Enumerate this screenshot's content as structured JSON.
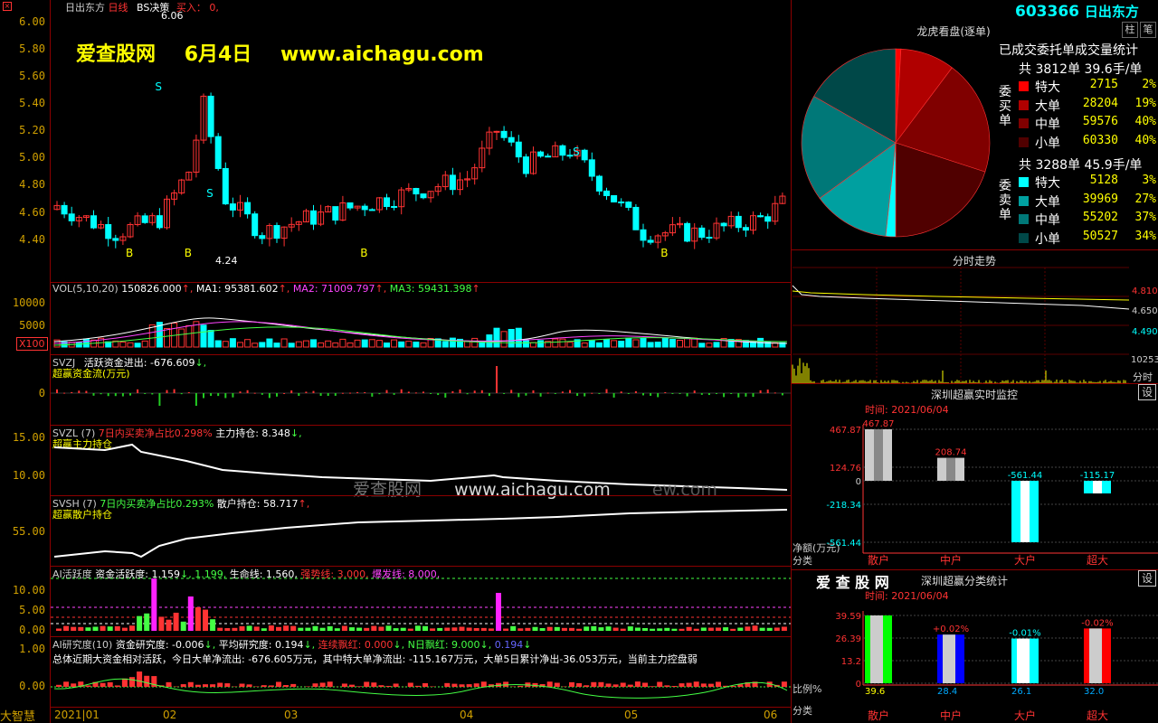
{
  "header": {
    "name": "日出东方",
    "period": "日线",
    "indicator": "BS决策",
    "buy_label": "买入：",
    "buy_value": "0,",
    "watermark_site": "爱查股网",
    "watermark_date": "6月4日",
    "watermark_url": "www.aichagu.com",
    "price_label": "6.06",
    "low_label": "4.24",
    "center_watermark_site": "爱查股网",
    "center_watermark_url": "www.aichagu.com",
    "center_watermark_tail": "ew.com"
  },
  "price_axis": [
    "6.00",
    "5.80",
    "5.60",
    "5.40",
    "5.20",
    "5.00",
    "4.80",
    "4.60",
    "4.40"
  ],
  "date_axis": {
    "corner": "大智慧",
    "labels": [
      "2021|01",
      "02",
      "03",
      "04",
      "05",
      "06"
    ]
  },
  "vol": {
    "title": "VOL(5,10,20)",
    "value": "150826.000",
    "ma1": "MA1: 95381.602",
    "ma2": "MA2: 71009.797",
    "ma3": "MA3: 59431.398",
    "axis": [
      "10000",
      "5000"
    ],
    "unit": "X100"
  },
  "svzj": {
    "title": "SVZJ",
    "desc": "活跃资金进出: -676.609",
    "sub": "超赢资金流(万元)",
    "axis": "0"
  },
  "svzl": {
    "title": "SVZL (7)",
    "desc1": "7日内买卖净占比0.298%",
    "desc2": "主力持仓: 8.348",
    "sub": "超赢主力持仓",
    "axis": [
      "15.00",
      "10.00"
    ]
  },
  "svsh": {
    "title": "SVSH (7)",
    "desc1": "7日内买卖净占比0.293%",
    "desc2": "散户持仓: 58.717",
    "sub": "超赢散户持仓",
    "axis": "55.00"
  },
  "ai_active": {
    "title": "AI活跃度",
    "d1": "资金活跃度: 1.159",
    "d2": "1.199,",
    "d3": "生命线: 1.560,",
    "d4": "强势线: 3.000,",
    "d5": "爆发线: 8.000,",
    "axis": [
      "10.00",
      "5.00",
      "0.00"
    ]
  },
  "ai_research": {
    "title": "AI研究度(10)",
    "d1": "资金研究度: -0.006",
    "d2": "平均研究度: 0.194",
    "d3": "连续飘红: 0.000",
    "d4": "N日飘红: 9.000",
    "d5": "0.194",
    "summary": "总体近期大资金相对活跃，今日大单净流出: -676.605万元，其中特大单净流出: -115.167万元，大单5日累计净出-36.053万元，当前主力控盘弱",
    "axis": [
      "1.00",
      "0.00"
    ]
  },
  "right": {
    "code": "603366",
    "name": "日出东方",
    "btn1": "柱",
    "btn2": "笔",
    "panel_title": "龙虎看盘(逐单)",
    "stat_title": "已成交委托单成交量统计",
    "buy": {
      "label": "委买单",
      "total": "共 3812单 39.6手/单",
      "rows": [
        {
          "name": "特大",
          "val": "2715",
          "pct": "2%",
          "color": "#ff0000"
        },
        {
          "name": "大单",
          "val": "28204",
          "pct": "19%",
          "color": "#b00000"
        },
        {
          "name": "中单",
          "val": "59576",
          "pct": "40%",
          "color": "#800000"
        },
        {
          "name": "小单",
          "val": "60330",
          "pct": "40%",
          "color": "#500000"
        }
      ]
    },
    "sell": {
      "label": "委卖单",
      "total": "共 3288单 45.9手/单",
      "rows": [
        {
          "name": "特大",
          "val": "5128",
          "pct": "3%",
          "color": "#00ffff"
        },
        {
          "name": "大单",
          "val": "39969",
          "pct": "27%",
          "color": "#00a0a0"
        },
        {
          "name": "中单",
          "val": "55202",
          "pct": "37%",
          "color": "#007878"
        },
        {
          "name": "小单",
          "val": "50527",
          "pct": "34%",
          "color": "#004848"
        }
      ]
    },
    "intraday_title": "分时走势",
    "intraday_axis": [
      "4.810",
      "4.650",
      "4.490"
    ],
    "intraday_vol": "10253",
    "intraday_btn": "分时",
    "monitor_title": "深圳超赢实时监控",
    "monitor_btn": "设",
    "monitor_time": "时间: 2021/06/04",
    "monitor_axis": [
      "467.87",
      "124.76",
      "0",
      "-218.34",
      "-561.44"
    ],
    "monitor_ylabel": "净额(万元)",
    "monitor_xlabel": "分类",
    "monitor_bars": [
      {
        "cat": "散户",
        "value": "467.87"
      },
      {
        "cat": "中户",
        "value": "208.74"
      },
      {
        "cat": "大户",
        "value": "-561.44"
      },
      {
        "cat": "超大",
        "value": "-115.17"
      }
    ],
    "class_watermark": "爱 查 股 网",
    "class_title": "深圳超赢分类统计",
    "class_btn": "设",
    "class_time": "时间: 2021/06/04",
    "class_axis": [
      "39.59",
      "26.39",
      "13.2",
      "0"
    ],
    "class_ylabel": "比例%",
    "class_xlabel": "分类",
    "class_bars": [
      {
        "cat": "散户",
        "value": "39.6",
        "delta": ""
      },
      {
        "cat": "中户",
        "value": "28.4",
        "delta": "+0.02%"
      },
      {
        "cat": "大户",
        "value": "26.1",
        "delta": "-0.01%"
      },
      {
        "cat": "超大",
        "value": "32.0",
        "delta": "-0.02%"
      }
    ]
  },
  "chart_data": [
    {
      "type": "pie",
      "title": "龙虎看盘(逐单)",
      "categories": [
        "委买特大",
        "委买大单",
        "委买中单",
        "委买小单",
        "委卖特大",
        "委卖大单",
        "委卖中单",
        "委卖小单"
      ],
      "values": [
        2715,
        28204,
        59576,
        60330,
        5128,
        39969,
        55202,
        50527
      ]
    },
    {
      "type": "bar",
      "title": "深圳超赢实时监控",
      "categories": [
        "散户",
        "中户",
        "大户",
        "超大"
      ],
      "values": [
        467.87,
        208.74,
        -561.44,
        -115.17
      ],
      "ylabel": "净额(万元)",
      "xlabel": "分类",
      "ylim": [
        -561.44,
        467.87
      ]
    },
    {
      "type": "bar",
      "title": "深圳超赢分类统计",
      "categories": [
        "散户",
        "中户",
        "大户",
        "超大"
      ],
      "values": [
        39.6,
        28.4,
        26.1,
        32.0
      ],
      "ylabel": "比例%",
      "xlabel": "分类",
      "ylim": [
        0,
        39.59
      ]
    }
  ],
  "colors": {
    "up": "#ff3333",
    "down": "#00ffff",
    "border": "#8b0000",
    "axis_text": "#d0a000",
    "watermark": "#ffff00"
  }
}
